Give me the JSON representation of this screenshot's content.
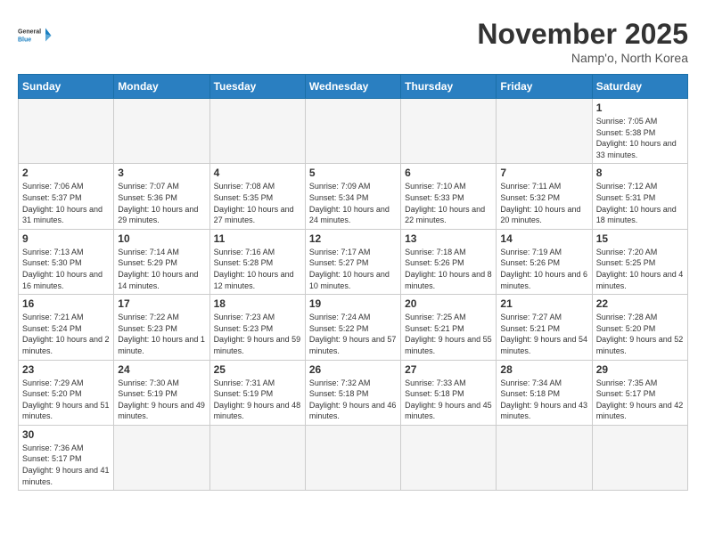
{
  "header": {
    "logo_general": "General",
    "logo_blue": "Blue",
    "month": "November 2025",
    "location": "Namp'o, North Korea"
  },
  "weekdays": [
    "Sunday",
    "Monday",
    "Tuesday",
    "Wednesday",
    "Thursday",
    "Friday",
    "Saturday"
  ],
  "days": {
    "d1": {
      "num": "1",
      "sunrise": "Sunrise: 7:05 AM",
      "sunset": "Sunset: 5:38 PM",
      "daylight": "Daylight: 10 hours and 33 minutes."
    },
    "d2": {
      "num": "2",
      "sunrise": "Sunrise: 7:06 AM",
      "sunset": "Sunset: 5:37 PM",
      "daylight": "Daylight: 10 hours and 31 minutes."
    },
    "d3": {
      "num": "3",
      "sunrise": "Sunrise: 7:07 AM",
      "sunset": "Sunset: 5:36 PM",
      "daylight": "Daylight: 10 hours and 29 minutes."
    },
    "d4": {
      "num": "4",
      "sunrise": "Sunrise: 7:08 AM",
      "sunset": "Sunset: 5:35 PM",
      "daylight": "Daylight: 10 hours and 27 minutes."
    },
    "d5": {
      "num": "5",
      "sunrise": "Sunrise: 7:09 AM",
      "sunset": "Sunset: 5:34 PM",
      "daylight": "Daylight: 10 hours and 24 minutes."
    },
    "d6": {
      "num": "6",
      "sunrise": "Sunrise: 7:10 AM",
      "sunset": "Sunset: 5:33 PM",
      "daylight": "Daylight: 10 hours and 22 minutes."
    },
    "d7": {
      "num": "7",
      "sunrise": "Sunrise: 7:11 AM",
      "sunset": "Sunset: 5:32 PM",
      "daylight": "Daylight: 10 hours and 20 minutes."
    },
    "d8": {
      "num": "8",
      "sunrise": "Sunrise: 7:12 AM",
      "sunset": "Sunset: 5:31 PM",
      "daylight": "Daylight: 10 hours and 18 minutes."
    },
    "d9": {
      "num": "9",
      "sunrise": "Sunrise: 7:13 AM",
      "sunset": "Sunset: 5:30 PM",
      "daylight": "Daylight: 10 hours and 16 minutes."
    },
    "d10": {
      "num": "10",
      "sunrise": "Sunrise: 7:14 AM",
      "sunset": "Sunset: 5:29 PM",
      "daylight": "Daylight: 10 hours and 14 minutes."
    },
    "d11": {
      "num": "11",
      "sunrise": "Sunrise: 7:16 AM",
      "sunset": "Sunset: 5:28 PM",
      "daylight": "Daylight: 10 hours and 12 minutes."
    },
    "d12": {
      "num": "12",
      "sunrise": "Sunrise: 7:17 AM",
      "sunset": "Sunset: 5:27 PM",
      "daylight": "Daylight: 10 hours and 10 minutes."
    },
    "d13": {
      "num": "13",
      "sunrise": "Sunrise: 7:18 AM",
      "sunset": "Sunset: 5:26 PM",
      "daylight": "Daylight: 10 hours and 8 minutes."
    },
    "d14": {
      "num": "14",
      "sunrise": "Sunrise: 7:19 AM",
      "sunset": "Sunset: 5:26 PM",
      "daylight": "Daylight: 10 hours and 6 minutes."
    },
    "d15": {
      "num": "15",
      "sunrise": "Sunrise: 7:20 AM",
      "sunset": "Sunset: 5:25 PM",
      "daylight": "Daylight: 10 hours and 4 minutes."
    },
    "d16": {
      "num": "16",
      "sunrise": "Sunrise: 7:21 AM",
      "sunset": "Sunset: 5:24 PM",
      "daylight": "Daylight: 10 hours and 2 minutes."
    },
    "d17": {
      "num": "17",
      "sunrise": "Sunrise: 7:22 AM",
      "sunset": "Sunset: 5:23 PM",
      "daylight": "Daylight: 10 hours and 1 minute."
    },
    "d18": {
      "num": "18",
      "sunrise": "Sunrise: 7:23 AM",
      "sunset": "Sunset: 5:23 PM",
      "daylight": "Daylight: 9 hours and 59 minutes."
    },
    "d19": {
      "num": "19",
      "sunrise": "Sunrise: 7:24 AM",
      "sunset": "Sunset: 5:22 PM",
      "daylight": "Daylight: 9 hours and 57 minutes."
    },
    "d20": {
      "num": "20",
      "sunrise": "Sunrise: 7:25 AM",
      "sunset": "Sunset: 5:21 PM",
      "daylight": "Daylight: 9 hours and 55 minutes."
    },
    "d21": {
      "num": "21",
      "sunrise": "Sunrise: 7:27 AM",
      "sunset": "Sunset: 5:21 PM",
      "daylight": "Daylight: 9 hours and 54 minutes."
    },
    "d22": {
      "num": "22",
      "sunrise": "Sunrise: 7:28 AM",
      "sunset": "Sunset: 5:20 PM",
      "daylight": "Daylight: 9 hours and 52 minutes."
    },
    "d23": {
      "num": "23",
      "sunrise": "Sunrise: 7:29 AM",
      "sunset": "Sunset: 5:20 PM",
      "daylight": "Daylight: 9 hours and 51 minutes."
    },
    "d24": {
      "num": "24",
      "sunrise": "Sunrise: 7:30 AM",
      "sunset": "Sunset: 5:19 PM",
      "daylight": "Daylight: 9 hours and 49 minutes."
    },
    "d25": {
      "num": "25",
      "sunrise": "Sunrise: 7:31 AM",
      "sunset": "Sunset: 5:19 PM",
      "daylight": "Daylight: 9 hours and 48 minutes."
    },
    "d26": {
      "num": "26",
      "sunrise": "Sunrise: 7:32 AM",
      "sunset": "Sunset: 5:18 PM",
      "daylight": "Daylight: 9 hours and 46 minutes."
    },
    "d27": {
      "num": "27",
      "sunrise": "Sunrise: 7:33 AM",
      "sunset": "Sunset: 5:18 PM",
      "daylight": "Daylight: 9 hours and 45 minutes."
    },
    "d28": {
      "num": "28",
      "sunrise": "Sunrise: 7:34 AM",
      "sunset": "Sunset: 5:18 PM",
      "daylight": "Daylight: 9 hours and 43 minutes."
    },
    "d29": {
      "num": "29",
      "sunrise": "Sunrise: 7:35 AM",
      "sunset": "Sunset: 5:17 PM",
      "daylight": "Daylight: 9 hours and 42 minutes."
    },
    "d30": {
      "num": "30",
      "sunrise": "Sunrise: 7:36 AM",
      "sunset": "Sunset: 5:17 PM",
      "daylight": "Daylight: 9 hours and 41 minutes."
    }
  }
}
